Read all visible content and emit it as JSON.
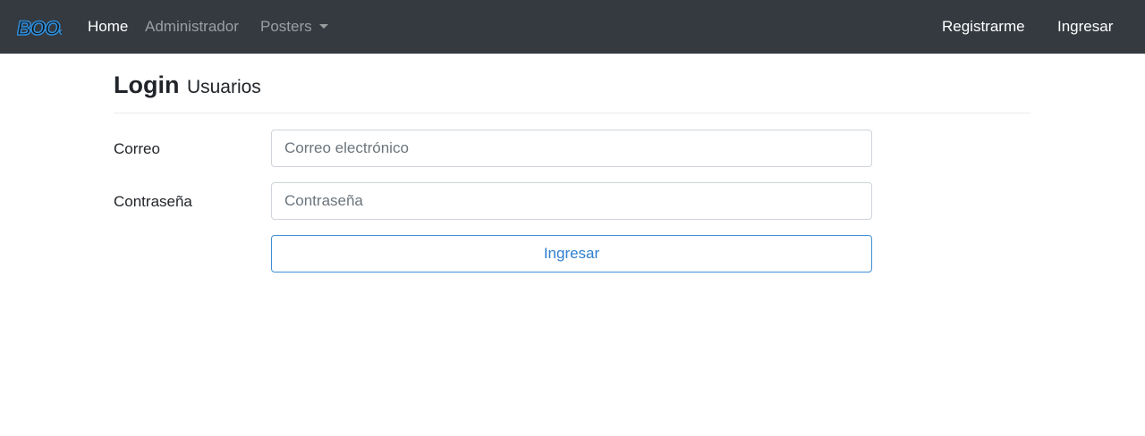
{
  "brand": {
    "logo_text": "BOOJ",
    "color": "#2f8cd8"
  },
  "nav": {
    "home": "Home",
    "admin": "Administrador",
    "posters": "Posters",
    "register": "Registrarme",
    "login": "Ingresar"
  },
  "page": {
    "title": "Login",
    "subtitle": "Usuarios"
  },
  "form": {
    "email_label": "Correo",
    "email_placeholder": "Correo electrónico",
    "email_value": "",
    "password_label": "Contraseña",
    "password_placeholder": "Contraseña",
    "password_value": "",
    "submit_label": "Ingresar"
  },
  "colors": {
    "navbar_bg": "#343a40",
    "primary_outline": "#3f8fd6"
  }
}
